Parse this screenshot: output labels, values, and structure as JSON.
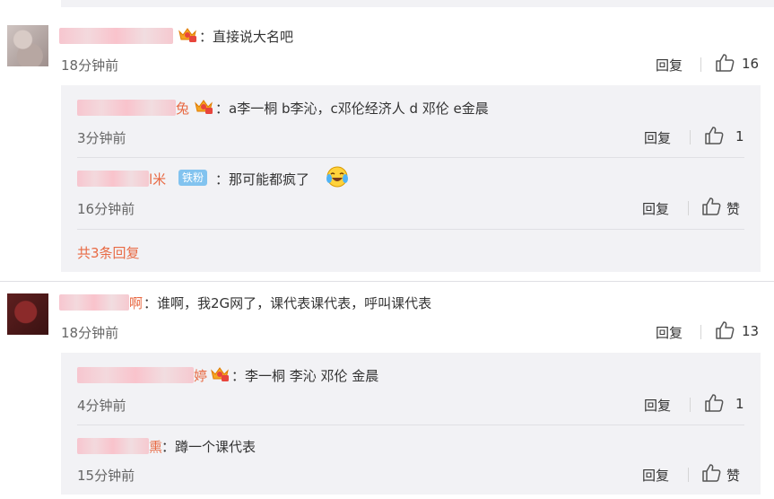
{
  "comments": [
    {
      "content": "：直接说大名吧",
      "time": "18分钟前",
      "reply_label": "回复",
      "like_count": "16",
      "replies": [
        {
          "user_suffix": "兔",
          "content": "：a李一桐 b李沁，c邓伦经济人 d 邓伦  e金晨",
          "time": "3分钟前",
          "reply_label": "回复",
          "like_count": "1"
        },
        {
          "user_suffix": "l米",
          "badge": "铁粉",
          "content": "：那可能都疯了",
          "time": "16分钟前",
          "reply_label": "回复",
          "like_count": "赞"
        }
      ],
      "more_replies": "共3条回复"
    },
    {
      "user_suffix": "啊",
      "content": "：谁啊，我2G网了，课代表课代表，呼叫课代表",
      "time": "18分钟前",
      "reply_label": "回复",
      "like_count": "13",
      "replies": [
        {
          "user_suffix": "婷",
          "content": "：李一桐 李沁 邓伦 金晨",
          "time": "4分钟前",
          "reply_label": "回复",
          "like_count": "1"
        },
        {
          "user_suffix": "熏",
          "content": "：蹲一个课代表",
          "time": "15分钟前",
          "reply_label": "回复",
          "like_count": "赞"
        }
      ]
    }
  ],
  "colors": {
    "username": "#e86a44",
    "panel": "#f2f2f5",
    "fan_badge": "#82c3ef"
  },
  "icons": [
    "thumbs-up-icon",
    "crown-badge-icon",
    "laughing-crying-emoji-icon"
  ]
}
